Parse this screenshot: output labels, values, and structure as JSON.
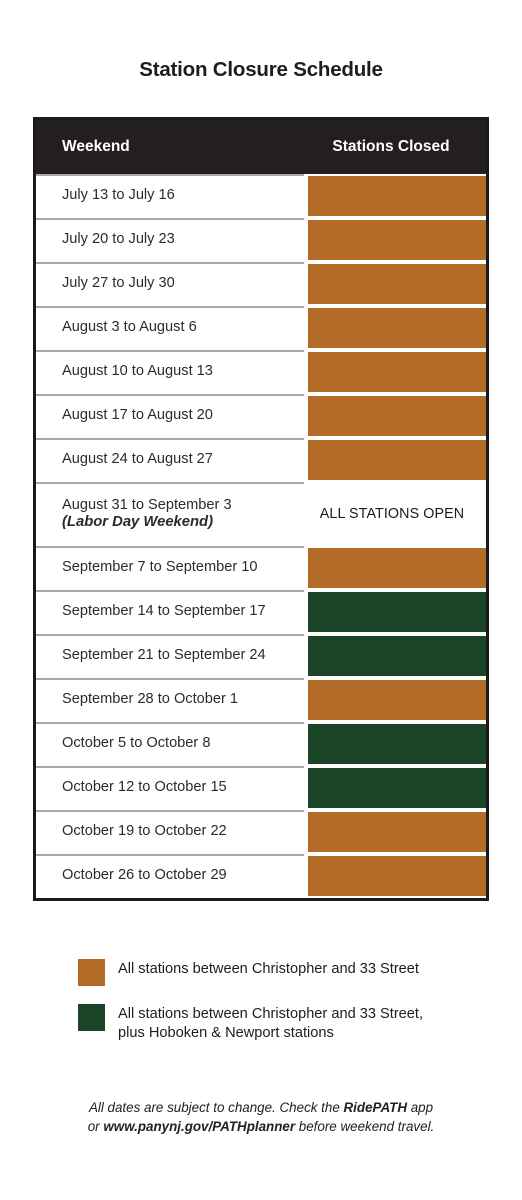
{
  "title": "Station Closure Schedule",
  "colors": {
    "orange": "#b36c28",
    "green": "#1b4428",
    "header_bg": "#231f20",
    "border": "#1b1b1b",
    "divider": "#a9a9a9"
  },
  "table": {
    "columns": [
      "Weekend",
      "Stations Closed"
    ],
    "rows": [
      {
        "weekend": "July 13 to July 16",
        "note": "",
        "status": "orange",
        "status_label": ""
      },
      {
        "weekend": "July 20 to July 23",
        "note": "",
        "status": "orange",
        "status_label": ""
      },
      {
        "weekend": "July 27 to July 30",
        "note": "",
        "status": "orange",
        "status_label": ""
      },
      {
        "weekend": "August 3 to August 6",
        "note": "",
        "status": "orange",
        "status_label": ""
      },
      {
        "weekend": "August 10 to August 13",
        "note": "",
        "status": "orange",
        "status_label": ""
      },
      {
        "weekend": "August 17 to August 20",
        "note": "",
        "status": "orange",
        "status_label": ""
      },
      {
        "weekend": "August 24 to August 27",
        "note": "",
        "status": "orange",
        "status_label": ""
      },
      {
        "weekend": "August 31 to September 3",
        "note": "(Labor Day Weekend)",
        "status": "open",
        "status_label": "ALL STATIONS OPEN"
      },
      {
        "weekend": "September 7 to September 10",
        "note": "",
        "status": "orange",
        "status_label": ""
      },
      {
        "weekend": "September 14 to September 17",
        "note": "",
        "status": "green",
        "status_label": ""
      },
      {
        "weekend": "September 21 to September 24",
        "note": "",
        "status": "green",
        "status_label": ""
      },
      {
        "weekend": "September 28 to October 1",
        "note": "",
        "status": "orange",
        "status_label": ""
      },
      {
        "weekend": "October 5 to October 8",
        "note": "",
        "status": "green",
        "status_label": ""
      },
      {
        "weekend": "October 12 to October 15",
        "note": "",
        "status": "green",
        "status_label": ""
      },
      {
        "weekend": "October 19 to October 22",
        "note": "",
        "status": "orange",
        "status_label": ""
      },
      {
        "weekend": "October 26 to October 29",
        "note": "",
        "status": "orange",
        "status_label": ""
      }
    ]
  },
  "legend": [
    {
      "color": "orange",
      "lines": [
        "All stations between Christopher and 33 Street"
      ]
    },
    {
      "color": "green",
      "lines": [
        "All stations between Christopher and 33 Street,",
        "plus Hoboken & Newport stations"
      ]
    }
  ],
  "footnote": {
    "line1_a": "All dates are subject to change. Check the ",
    "line1_b": "RidePATH",
    "line1_c": " app",
    "line2_a": "or ",
    "line2_b": "www.panynj.gov/PATHplanner",
    "line2_c": " before weekend travel."
  }
}
